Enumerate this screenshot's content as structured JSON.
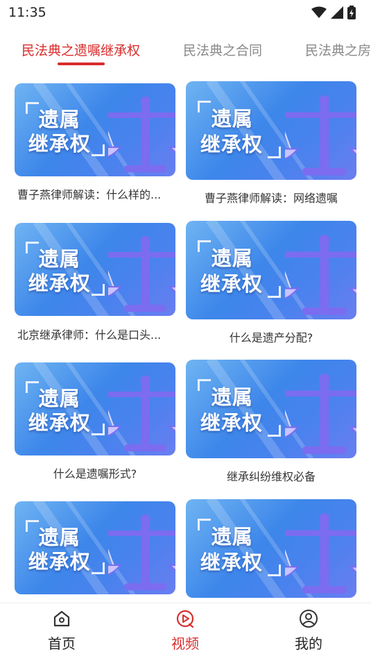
{
  "status_bar": {
    "time": "11:35",
    "icons": [
      "wifi-icon",
      "signal-icon",
      "battery-charging-icon"
    ]
  },
  "tabs": [
    {
      "label": "民法典之遗嘱继承权",
      "active": true
    },
    {
      "label": "民法典之合同",
      "active": false
    },
    {
      "label": "民法典之房",
      "active": false
    }
  ],
  "thumbnail": {
    "line1": "遗属",
    "line2": "继承权",
    "icon": "scale-balance-icon"
  },
  "videos": [
    {
      "title": "曹子燕律师解读：什么样的..."
    },
    {
      "title": "曹子燕律师解读：网络遗嘱"
    },
    {
      "title": "北京继承律师：什么是口头..."
    },
    {
      "title": "什么是遗产分配?"
    },
    {
      "title": "什么是遗嘱形式?"
    },
    {
      "title": "继承纠纷维权必备"
    },
    {
      "title": ""
    },
    {
      "title": ""
    }
  ],
  "bottom_nav": [
    {
      "label": "首页",
      "icon": "home-icon",
      "active": false
    },
    {
      "label": "视频",
      "icon": "video-play-icon",
      "active": true
    },
    {
      "label": "我的",
      "icon": "profile-icon",
      "active": false
    }
  ],
  "colors": {
    "accent": "#d92d2d",
    "thumb_blue": "#3d86ea",
    "scale_purple": "#7b6cf0"
  }
}
